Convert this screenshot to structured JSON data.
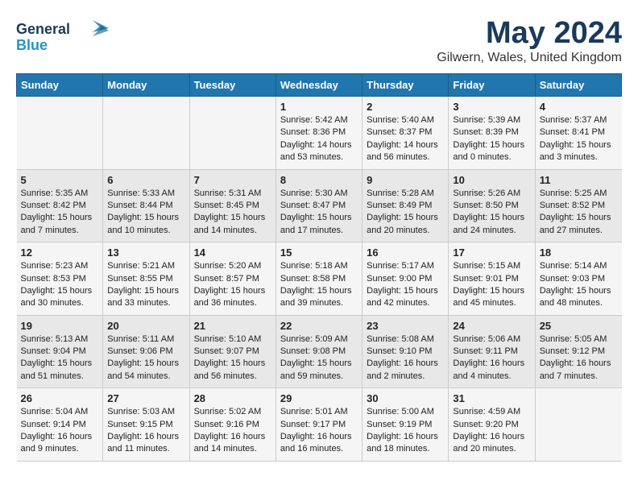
{
  "header": {
    "logo_line1": "General",
    "logo_line2": "Blue",
    "month": "May 2024",
    "location": "Gilwern, Wales, United Kingdom"
  },
  "days_of_week": [
    "Sunday",
    "Monday",
    "Tuesday",
    "Wednesday",
    "Thursday",
    "Friday",
    "Saturday"
  ],
  "weeks": [
    [
      {
        "day": "",
        "info": ""
      },
      {
        "day": "",
        "info": ""
      },
      {
        "day": "",
        "info": ""
      },
      {
        "day": "1",
        "info": "Sunrise: 5:42 AM\nSunset: 8:36 PM\nDaylight: 14 hours and 53 minutes."
      },
      {
        "day": "2",
        "info": "Sunrise: 5:40 AM\nSunset: 8:37 PM\nDaylight: 14 hours and 56 minutes."
      },
      {
        "day": "3",
        "info": "Sunrise: 5:39 AM\nSunset: 8:39 PM\nDaylight: 15 hours and 0 minutes."
      },
      {
        "day": "4",
        "info": "Sunrise: 5:37 AM\nSunset: 8:41 PM\nDaylight: 15 hours and 3 minutes."
      }
    ],
    [
      {
        "day": "5",
        "info": "Sunrise: 5:35 AM\nSunset: 8:42 PM\nDaylight: 15 hours and 7 minutes."
      },
      {
        "day": "6",
        "info": "Sunrise: 5:33 AM\nSunset: 8:44 PM\nDaylight: 15 hours and 10 minutes."
      },
      {
        "day": "7",
        "info": "Sunrise: 5:31 AM\nSunset: 8:45 PM\nDaylight: 15 hours and 14 minutes."
      },
      {
        "day": "8",
        "info": "Sunrise: 5:30 AM\nSunset: 8:47 PM\nDaylight: 15 hours and 17 minutes."
      },
      {
        "day": "9",
        "info": "Sunrise: 5:28 AM\nSunset: 8:49 PM\nDaylight: 15 hours and 20 minutes."
      },
      {
        "day": "10",
        "info": "Sunrise: 5:26 AM\nSunset: 8:50 PM\nDaylight: 15 hours and 24 minutes."
      },
      {
        "day": "11",
        "info": "Sunrise: 5:25 AM\nSunset: 8:52 PM\nDaylight: 15 hours and 27 minutes."
      }
    ],
    [
      {
        "day": "12",
        "info": "Sunrise: 5:23 AM\nSunset: 8:53 PM\nDaylight: 15 hours and 30 minutes."
      },
      {
        "day": "13",
        "info": "Sunrise: 5:21 AM\nSunset: 8:55 PM\nDaylight: 15 hours and 33 minutes."
      },
      {
        "day": "14",
        "info": "Sunrise: 5:20 AM\nSunset: 8:57 PM\nDaylight: 15 hours and 36 minutes."
      },
      {
        "day": "15",
        "info": "Sunrise: 5:18 AM\nSunset: 8:58 PM\nDaylight: 15 hours and 39 minutes."
      },
      {
        "day": "16",
        "info": "Sunrise: 5:17 AM\nSunset: 9:00 PM\nDaylight: 15 hours and 42 minutes."
      },
      {
        "day": "17",
        "info": "Sunrise: 5:15 AM\nSunset: 9:01 PM\nDaylight: 15 hours and 45 minutes."
      },
      {
        "day": "18",
        "info": "Sunrise: 5:14 AM\nSunset: 9:03 PM\nDaylight: 15 hours and 48 minutes."
      }
    ],
    [
      {
        "day": "19",
        "info": "Sunrise: 5:13 AM\nSunset: 9:04 PM\nDaylight: 15 hours and 51 minutes."
      },
      {
        "day": "20",
        "info": "Sunrise: 5:11 AM\nSunset: 9:06 PM\nDaylight: 15 hours and 54 minutes."
      },
      {
        "day": "21",
        "info": "Sunrise: 5:10 AM\nSunset: 9:07 PM\nDaylight: 15 hours and 56 minutes."
      },
      {
        "day": "22",
        "info": "Sunrise: 5:09 AM\nSunset: 9:08 PM\nDaylight: 15 hours and 59 minutes."
      },
      {
        "day": "23",
        "info": "Sunrise: 5:08 AM\nSunset: 9:10 PM\nDaylight: 16 hours and 2 minutes."
      },
      {
        "day": "24",
        "info": "Sunrise: 5:06 AM\nSunset: 9:11 PM\nDaylight: 16 hours and 4 minutes."
      },
      {
        "day": "25",
        "info": "Sunrise: 5:05 AM\nSunset: 9:12 PM\nDaylight: 16 hours and 7 minutes."
      }
    ],
    [
      {
        "day": "26",
        "info": "Sunrise: 5:04 AM\nSunset: 9:14 PM\nDaylight: 16 hours and 9 minutes."
      },
      {
        "day": "27",
        "info": "Sunrise: 5:03 AM\nSunset: 9:15 PM\nDaylight: 16 hours and 11 minutes."
      },
      {
        "day": "28",
        "info": "Sunrise: 5:02 AM\nSunset: 9:16 PM\nDaylight: 16 hours and 14 minutes."
      },
      {
        "day": "29",
        "info": "Sunrise: 5:01 AM\nSunset: 9:17 PM\nDaylight: 16 hours and 16 minutes."
      },
      {
        "day": "30",
        "info": "Sunrise: 5:00 AM\nSunset: 9:19 PM\nDaylight: 16 hours and 18 minutes."
      },
      {
        "day": "31",
        "info": "Sunrise: 4:59 AM\nSunset: 9:20 PM\nDaylight: 16 hours and 20 minutes."
      },
      {
        "day": "",
        "info": ""
      }
    ]
  ]
}
